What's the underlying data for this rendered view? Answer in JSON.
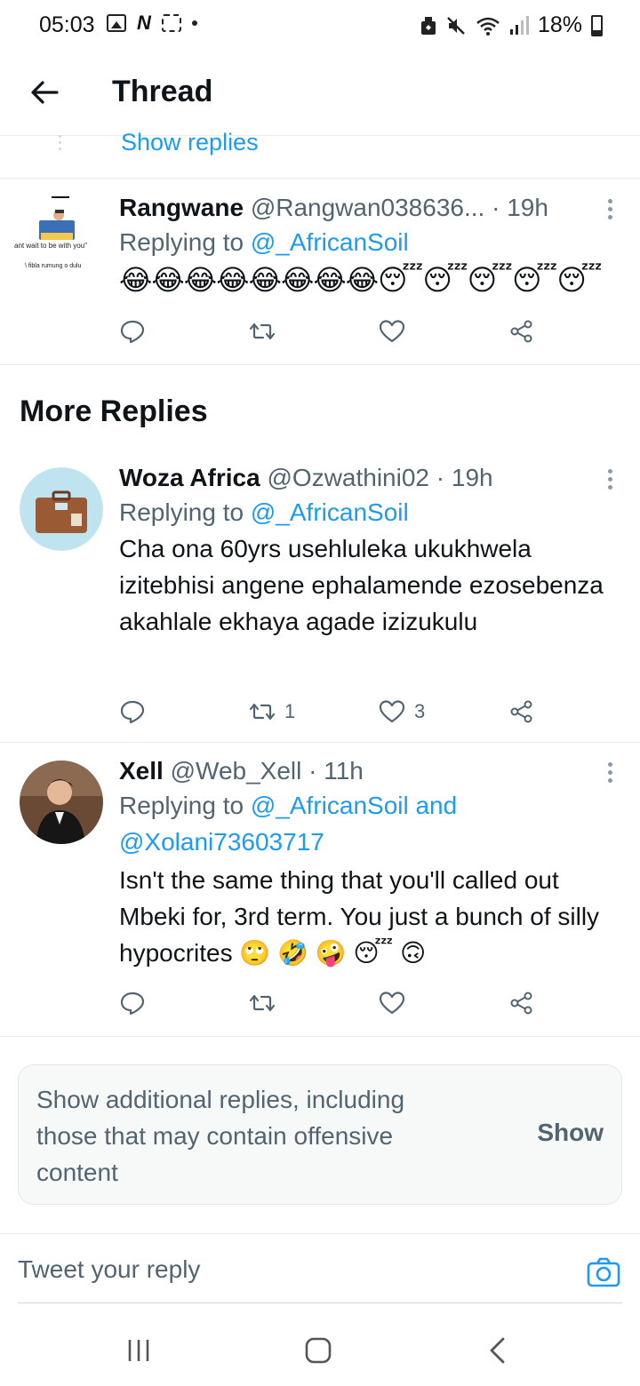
{
  "status_bar": {
    "time": "05:03",
    "battery": "18%",
    "icons": [
      "image-icon",
      "n-icon",
      "screenshot-icon",
      "dot-icon",
      "cleaner-icon",
      "mute-icon",
      "wifi-icon",
      "signal-icon",
      "battery-icon"
    ]
  },
  "header": {
    "title": "Thread"
  },
  "show_replies": "Show replies",
  "tweets": [
    {
      "name": "Rangwane",
      "handle": "@Rangwan038636...",
      "time": "· 19h",
      "replying_prefix": "Replying to ",
      "replying_to": "@_AfricanSoil",
      "text": "😂😂😂😂😂😂😂😂😴😴😴😴😴",
      "avatar_caption_1": "ant wait to be with you\"",
      "avatar_caption_2": "\\ fibla rumung o dulu",
      "retweets": "",
      "likes": ""
    },
    {
      "name": "Woza Africa",
      "handle": "@Ozwathini02",
      "time": "· 19h",
      "replying_prefix": "Replying to ",
      "replying_to": "@_AfricanSoil",
      "text": "Cha ona 60yrs usehluleka ukukhwela izitebhisi angene ephalamende ezosebenza akahlale ekhaya agade izizukulu",
      "retweets": "1",
      "likes": "3"
    },
    {
      "name": "Xell",
      "handle": "@Web_Xell",
      "time": "· 11h",
      "replying_prefix": "Replying to ",
      "replying_to": "@_AfricanSoil and @Xolani73603717",
      "text": "Isn't the same thing that you'll called out Mbeki for, 3rd term. You just a bunch of silly hypocrites 🙄 🤣 🤪 😴 🙃",
      "retweets": "",
      "likes": ""
    }
  ],
  "section_title": "More Replies",
  "additional_replies": {
    "text": "Show additional replies, including those that may contain offensive content",
    "button": "Show"
  },
  "composer": {
    "placeholder": "Tweet your reply"
  },
  "nav": {
    "icons": [
      "recents-icon",
      "home-icon",
      "back-icon"
    ]
  },
  "colors": {
    "accent": "#1d9bf0",
    "secondary_text": "#536471",
    "primary_text": "#0f1419"
  }
}
